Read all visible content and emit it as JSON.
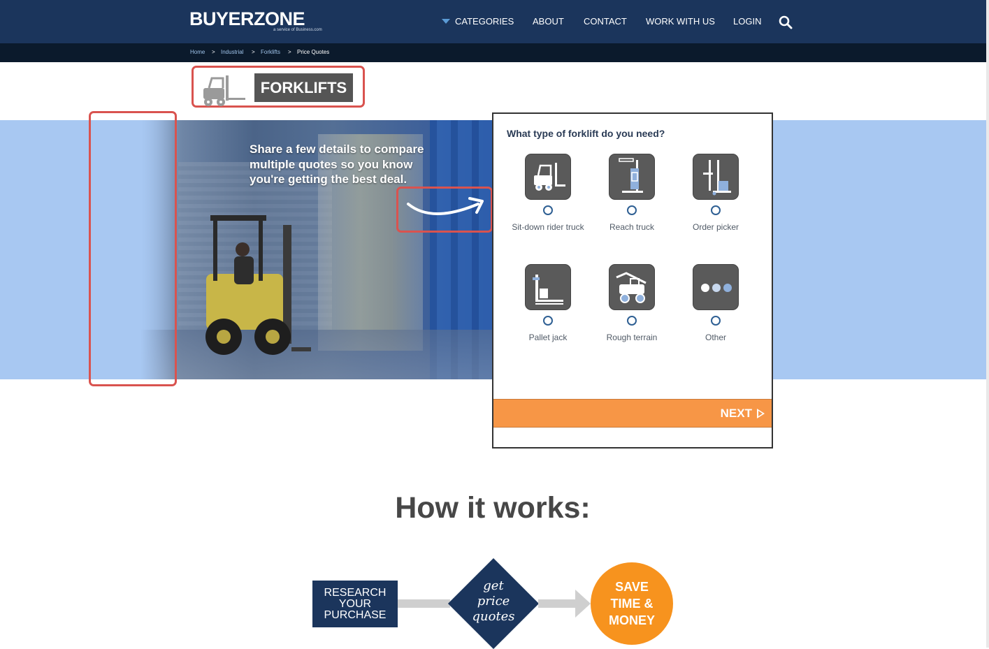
{
  "header": {
    "logo_text": "BUYERZONE",
    "logo_subtext": "a service of Business.com",
    "nav": {
      "categories": "CATEGORIES",
      "about": "ABOUT",
      "contact": "CONTACT",
      "work_with_us": "WORK WITH US",
      "login": "LOGIN"
    },
    "search_icon": "search-icon"
  },
  "breadcrumb": {
    "home": "Home",
    "industrial": "Industrial",
    "forklifts": "Forklifts",
    "current": "Price Quotes",
    "separator": ">"
  },
  "page_title": "FORKLIFTS",
  "hero": {
    "tagline_line1": "Share a few details to compare",
    "tagline_line2": "multiple quotes so you know",
    "tagline_line3": "you're getting the best deal."
  },
  "form": {
    "question": "What type of forklift do you need?",
    "options": [
      {
        "label": "Sit-down rider truck",
        "icon": "sit-down-forklift-icon"
      },
      {
        "label": "Reach truck",
        "icon": "reach-truck-icon"
      },
      {
        "label": "Order picker",
        "icon": "order-picker-icon"
      },
      {
        "label": "Pallet jack",
        "icon": "pallet-jack-icon"
      },
      {
        "label": "Rough terrain",
        "icon": "rough-terrain-icon"
      },
      {
        "label": "Other",
        "icon": "more-dots-icon"
      }
    ],
    "next_label": "NEXT"
  },
  "how_it_works": {
    "title": "How it works:",
    "step1_line1": "RESEARCH",
    "step1_line2": "YOUR",
    "step1_line3": "PURCHASE",
    "step2_line1": "get",
    "step2_line2": "price",
    "step2_line3": "quotes",
    "step3_line1": "SAVE",
    "step3_line2": "TIME &",
    "step3_line3": "MONEY"
  },
  "colors": {
    "header_bg": "#1b355c",
    "accent_orange": "#f79646",
    "hero_bg": "#a8c8f2",
    "highlight_red": "#d9534f"
  }
}
